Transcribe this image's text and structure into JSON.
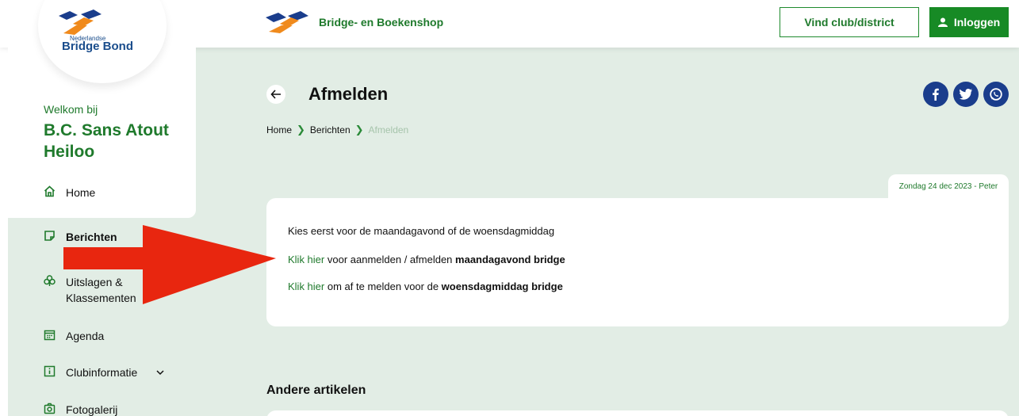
{
  "header": {
    "shop_label": "Bridge- en Boekenshop",
    "club_button": "Vind club/district",
    "login_button": "Inloggen"
  },
  "brand": {
    "small": "Nederlandse",
    "big": "Bridge Bond",
    "colors": {
      "orange": "#f08a1c",
      "navy": "#1a3d8c",
      "green": "#1f7a2c"
    }
  },
  "sidebar": {
    "welcome": "Welkom bij",
    "club": "B.C. Sans Atout Heiloo",
    "items": [
      {
        "label": "Home",
        "icon": "home-icon"
      },
      {
        "label": "Berichten",
        "icon": "note-icon"
      },
      {
        "label": "Uitslagen & Klassementen",
        "icon": "club-icon"
      },
      {
        "label": "Agenda",
        "icon": "calendar-icon"
      },
      {
        "label": "Clubinformatie",
        "icon": "info-icon"
      },
      {
        "label": "Fotogalerij",
        "icon": "camera-icon"
      }
    ]
  },
  "page": {
    "title": "Afmelden",
    "breadcrumb": [
      "Home",
      "Berichten",
      "Afmelden"
    ],
    "date": "Zondag 24 dec 2023 - Peter"
  },
  "article": {
    "line1": "Kies eerst voor de maandagavond of de woensdagmiddag",
    "line2_link": "Klik hier",
    "line2_text": " voor aanmelden / afmelden ",
    "line2_bold": "maandagavond bridge",
    "line3_link": "Klik hier",
    "line3_text": " om af te melden voor de ",
    "line3_bold": "woensdagmiddag bridge"
  },
  "others": {
    "title": "Andere artikelen"
  },
  "share": [
    "facebook-icon",
    "twitter-icon",
    "whatsapp-icon"
  ]
}
